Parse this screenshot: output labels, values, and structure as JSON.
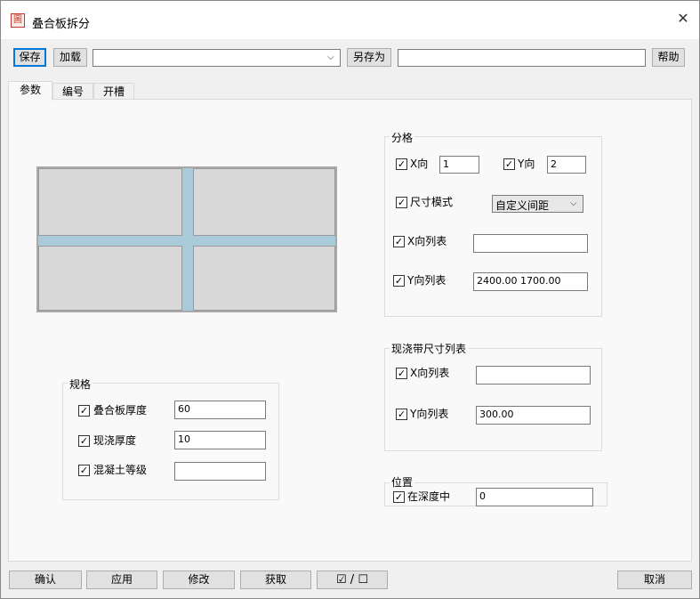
{
  "window": {
    "title": "叠合板拆分",
    "close_symbol": "✕",
    "icon_glyph": "圖"
  },
  "toolbar": {
    "save": "保存",
    "load": "加载",
    "preset_value": "",
    "save_as": "另存为",
    "save_as_name": "",
    "help": "帮助"
  },
  "tabs": [
    {
      "label": "参数",
      "active": true
    },
    {
      "label": "编号",
      "active": false
    },
    {
      "label": "开槽",
      "active": false
    }
  ],
  "specs": {
    "group_label": "规格",
    "rows": [
      {
        "label": "叠合板厚度",
        "checked": true,
        "value": "60"
      },
      {
        "label": "现浇厚度",
        "checked": true,
        "value": "10"
      },
      {
        "label": "混凝土等级",
        "checked": true,
        "value": ""
      }
    ]
  },
  "division": {
    "group_label": "分格",
    "x_dir": {
      "label": "X向",
      "checked": true,
      "value": "1"
    },
    "y_dir": {
      "label": "Y向",
      "checked": true,
      "value": "2"
    },
    "size_mode": {
      "label": "尺寸模式",
      "checked": true,
      "value": "自定义间距"
    },
    "x_list": {
      "label": "X向列表",
      "checked": true,
      "value": ""
    },
    "y_list": {
      "label": "Y向列表",
      "checked": true,
      "value": "2400.00 1700.00"
    }
  },
  "cast_strip": {
    "group_label": "现浇带尺寸列表",
    "x_list": {
      "label": "X向列表",
      "checked": true,
      "value": ""
    },
    "y_list": {
      "label": "Y向列表",
      "checked": true,
      "value": "300.00"
    }
  },
  "position": {
    "group_label": "位置",
    "center_depth": {
      "label": "在深度中",
      "checked": true,
      "value": "0"
    }
  },
  "footer": {
    "confirm": "确认",
    "apply": "应用",
    "modify": "修改",
    "fetch": "获取",
    "toggle_check": "☑ / ☐",
    "cancel": "取消"
  },
  "colors": {
    "strip": "#a9cbd9",
    "panel": "#d9d9d9",
    "accent": "#0078d7"
  },
  "check_mark": "✓"
}
